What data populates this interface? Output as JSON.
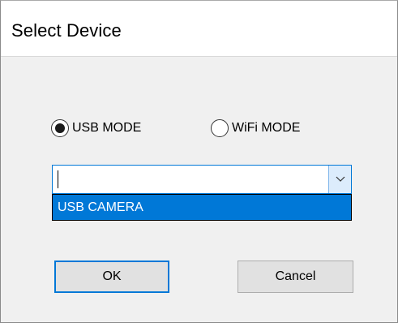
{
  "window": {
    "title": "Select Device"
  },
  "mode": {
    "usb_label": "USB MODE",
    "wifi_label": "WiFi MODE",
    "selected": "usb"
  },
  "device_combo": {
    "value": "",
    "options": [
      "USB CAMERA"
    ],
    "highlighted_option": "USB CAMERA"
  },
  "buttons": {
    "ok_label": "OK",
    "cancel_label": "Cancel"
  },
  "colors": {
    "accent": "#0078d7",
    "dialog_bg": "#f0f0f0",
    "button_bg": "#e1e1e1"
  }
}
